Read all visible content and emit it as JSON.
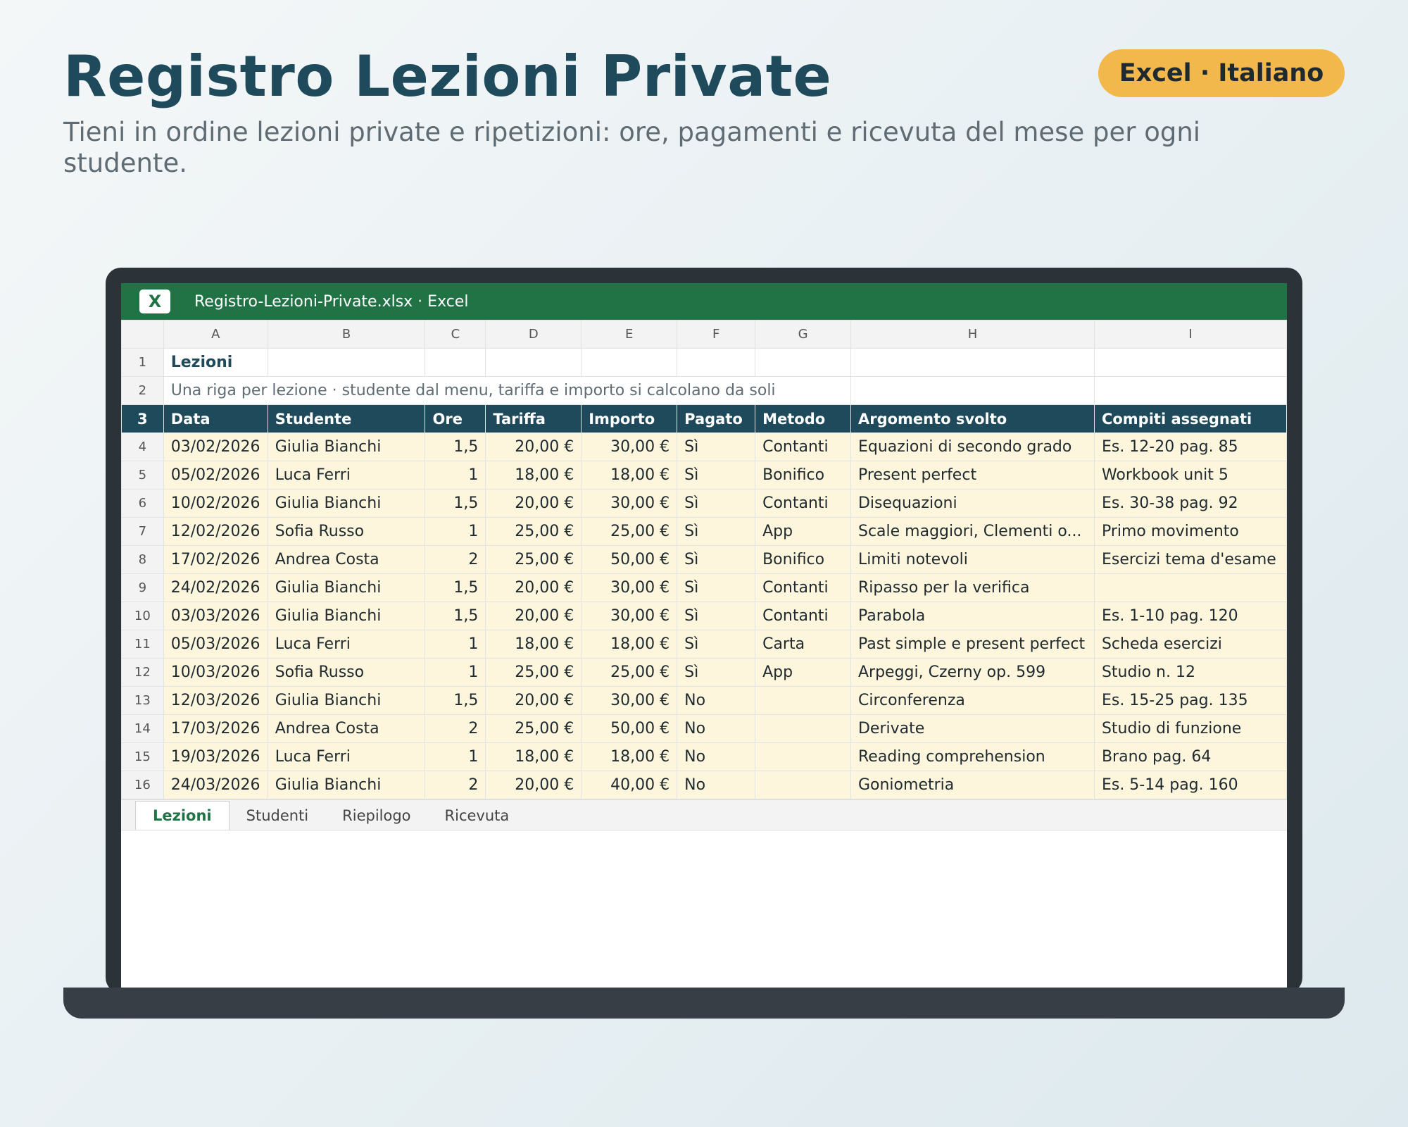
{
  "header": {
    "title": "Registro Lezioni Private",
    "subtitle": "Tieni in ordine lezioni private e ripetizioni: ore, pagamenti e ricevuta del mese per ogni studente.",
    "badge": "Excel · Italiano"
  },
  "window": {
    "app_icon": "X",
    "title": "Registro-Lezioni-Private.xlsx · Excel"
  },
  "sheet": {
    "column_letters": [
      "A",
      "B",
      "C",
      "D",
      "E",
      "F",
      "G",
      "H",
      "I"
    ],
    "row_numbers": [
      "1",
      "2",
      "3",
      "4",
      "5",
      "6",
      "7",
      "8",
      "9",
      "10",
      "11",
      "12",
      "13",
      "14",
      "15",
      "16"
    ],
    "title": "Lezioni",
    "note": "Una riga per lezione · studente dal menu, tariffa e importo si calcolano da soli",
    "headers": [
      "Data",
      "Studente",
      "Ore",
      "Tariffa",
      "Importo",
      "Pagato",
      "Metodo",
      "Argomento svolto",
      "Compiti assegnati"
    ],
    "rows": [
      [
        "03/02/2026",
        "Giulia Bianchi",
        "1,5",
        "20,00 €",
        "30,00 €",
        "Sì",
        "Contanti",
        "Equazioni di secondo grado",
        "Es. 12-20 pag. 85"
      ],
      [
        "05/02/2026",
        "Luca Ferri",
        "1",
        "18,00 €",
        "18,00 €",
        "Sì",
        "Bonifico",
        "Present perfect",
        "Workbook unit 5"
      ],
      [
        "10/02/2026",
        "Giulia Bianchi",
        "1,5",
        "20,00 €",
        "30,00 €",
        "Sì",
        "Contanti",
        "Disequazioni",
        "Es. 30-38 pag. 92"
      ],
      [
        "12/02/2026",
        "Sofia Russo",
        "1",
        "25,00 €",
        "25,00 €",
        "Sì",
        "App",
        "Scale maggiori, Clementi o...",
        "Primo movimento"
      ],
      [
        "17/02/2026",
        "Andrea Costa",
        "2",
        "25,00 €",
        "50,00 €",
        "Sì",
        "Bonifico",
        "Limiti notevoli",
        "Esercizi tema d'esame"
      ],
      [
        "24/02/2026",
        "Giulia Bianchi",
        "1,5",
        "20,00 €",
        "30,00 €",
        "Sì",
        "Contanti",
        "Ripasso per la verifica",
        ""
      ],
      [
        "03/03/2026",
        "Giulia Bianchi",
        "1,5",
        "20,00 €",
        "30,00 €",
        "Sì",
        "Contanti",
        "Parabola",
        "Es. 1-10 pag. 120"
      ],
      [
        "05/03/2026",
        "Luca Ferri",
        "1",
        "18,00 €",
        "18,00 €",
        "Sì",
        "Carta",
        "Past simple e present perfect",
        "Scheda esercizi"
      ],
      [
        "10/03/2026",
        "Sofia Russo",
        "1",
        "25,00 €",
        "25,00 €",
        "Sì",
        "App",
        "Arpeggi, Czerny op. 599",
        "Studio n. 12"
      ],
      [
        "12/03/2026",
        "Giulia Bianchi",
        "1,5",
        "20,00 €",
        "30,00 €",
        "No",
        "",
        "Circonferenza",
        "Es. 15-25 pag. 135"
      ],
      [
        "17/03/2026",
        "Andrea Costa",
        "2",
        "25,00 €",
        "50,00 €",
        "No",
        "",
        "Derivate",
        "Studio di funzione"
      ],
      [
        "19/03/2026",
        "Luca Ferri",
        "1",
        "18,00 €",
        "18,00 €",
        "No",
        "",
        "Reading comprehension",
        "Brano pag. 64"
      ],
      [
        "24/03/2026",
        "Giulia Bianchi",
        "2",
        "20,00 €",
        "40,00 €",
        "No",
        "",
        "Goniometria",
        "Es. 5-14 pag. 160"
      ]
    ]
  },
  "tabs": [
    "Lezioni",
    "Studenti",
    "Riepilogo",
    "Ricevuta"
  ],
  "colors": {
    "accent": "#217346",
    "header_fill": "#1e4a5c",
    "data_fill": "#fdf6dc",
    "badge": "#f2b84b"
  }
}
